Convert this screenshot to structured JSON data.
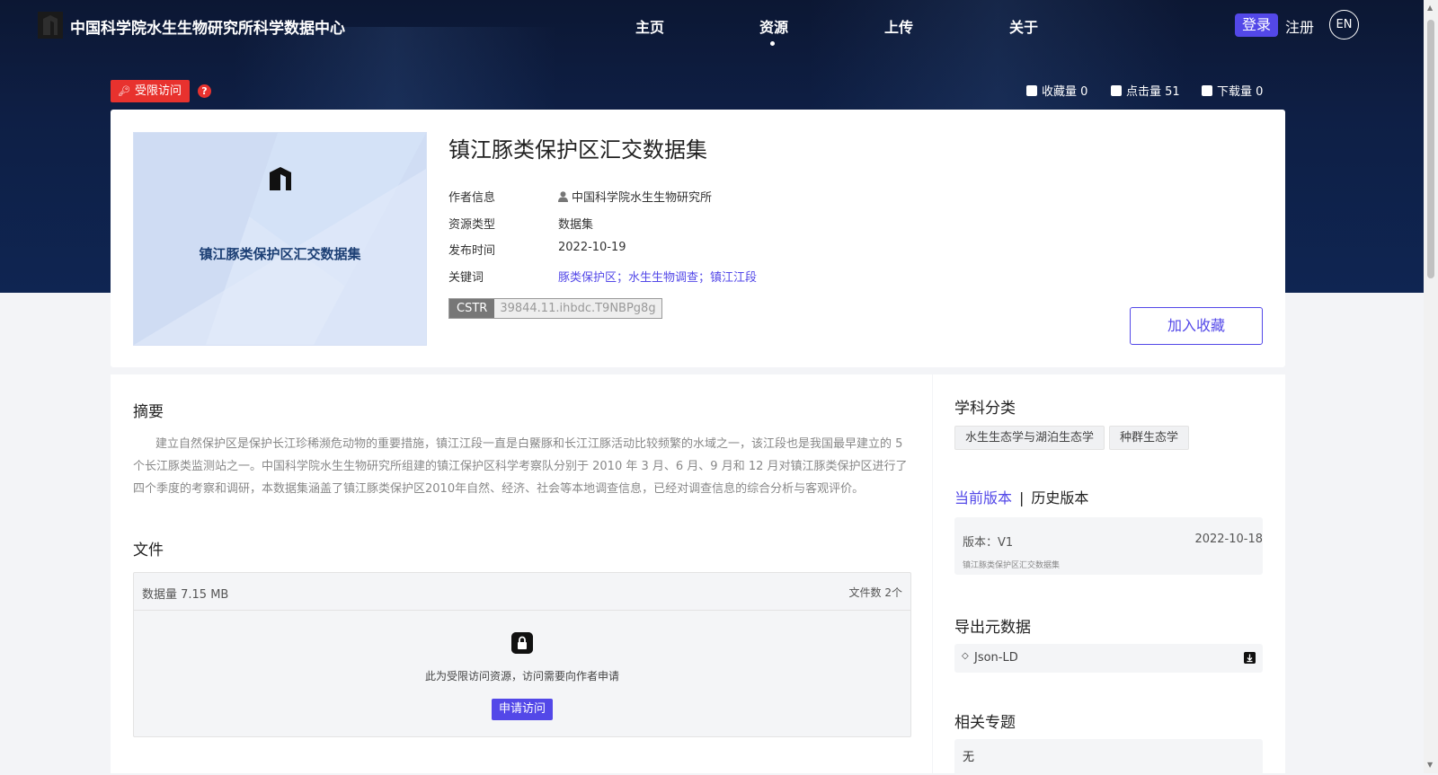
{
  "header": {
    "site_title": "中国科学院水生生物研究所科学数据中心",
    "nav": [
      {
        "label": "主页"
      },
      {
        "label": "资源",
        "active": true
      },
      {
        "label": "上传"
      },
      {
        "label": "关于"
      }
    ],
    "login_label": "登录",
    "register_label": "注册",
    "lang_label": "EN"
  },
  "access": {
    "restricted_label": "受限访问",
    "help_symbol": "?"
  },
  "stats": {
    "favorites": "收藏量 0",
    "clicks": "点击量 51",
    "downloads": "下载量 0"
  },
  "dataset": {
    "cover_title": "镇江豚类保护区汇交数据集",
    "title": "镇江豚类保护区汇交数据集",
    "meta": {
      "author_label": "作者信息",
      "author": "中国科学院水生生物研究所",
      "type_label": "资源类型",
      "type": "数据集",
      "date_label": "发布时间",
      "date": "2022-10-19",
      "keywords_label": "关键词",
      "keywords": "豚类保护区；水生生物调查；镇江江段"
    },
    "cstr_key": "CSTR",
    "cstr_value": "39844.11.ihbdc.T9NBPg8g",
    "favorite_button": "加入收藏"
  },
  "abstract": {
    "heading": "摘要",
    "text": "建立自然保护区是保护长江珍稀濒危动物的重要措施，镇江江段一直是白鱀豚和长江江豚活动比较频繁的水域之一，该江段也是我国最早建立的 5 个长江豚类监测站之一。中国科学院水生生物研究所组建的镇江保护区科学考察队分别于 2010 年 3 月、6 月、9 月和 12 月对镇江豚类保护区进行了四个季度的考察和调研，本数据集涵盖了镇江豚类保护区2010年自然、经济、社会等本地调查信息，已经对调查信息的综合分析与客观评价。"
  },
  "files": {
    "heading": "文件",
    "size": "数据量 7.15 MB",
    "count": "文件数 2个",
    "restricted_message": "此为受限访问资源，访问需要向作者申请",
    "apply_button": "申请访问"
  },
  "sidebar": {
    "subject_heading": "学科分类",
    "subjects": [
      "水生生态学与湖泊生态学",
      "种群生态学"
    ],
    "version_tabs": {
      "current": "当前版本",
      "separator": "|",
      "history": "历史版本"
    },
    "version": {
      "label": "版本：V1",
      "date": "2022-10-18",
      "name": "镇江豚类保护区汇交数据集"
    },
    "export_heading": "导出元数据",
    "export_format": "Json-LD",
    "related_heading": "相关专题",
    "related_value": "无"
  },
  "colors": {
    "accent": "#5348e8",
    "restricted": "#e8322e",
    "hero_bg": "#0e1f45"
  }
}
